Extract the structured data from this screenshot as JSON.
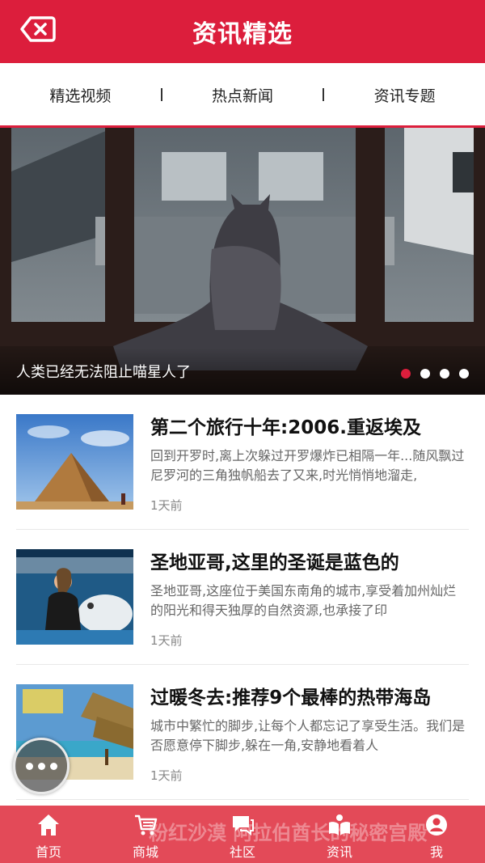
{
  "header": {
    "title": "资讯精选"
  },
  "tabs": [
    {
      "label": "精选视频"
    },
    {
      "label": "热点新闻"
    },
    {
      "label": "资讯专题"
    }
  ],
  "banner": {
    "caption": "人类已经无法阻止喵星人了",
    "slide_count": 4,
    "active_slide": 1
  },
  "articles": [
    {
      "title": "第二个旅行十年:2006.重返埃及",
      "desc": "回到开罗时,离上次躲过开罗爆炸已相隔一年...随风飘过尼罗河的三角独帆船去了又来,时光悄悄地溜走,",
      "time": "1天前",
      "thumb": "pyramid"
    },
    {
      "title": "圣地亚哥,这里的圣诞是蓝色的",
      "desc": "圣地亚哥,这座位于美国东南角的城市,享受着加州灿烂的阳光和得天独厚的自然资源,也承接了印",
      "time": "1天前",
      "thumb": "beluga"
    },
    {
      "title": "过暖冬去:推荐9个最棒的热带海岛",
      "desc": "城市中繁忙的脚步,让每个人都忘记了享受生活。我们是否愿意停下脚步,躲在一角,安静地看着人",
      "time": "1天前",
      "thumb": "beach"
    }
  ],
  "ghost_title": "粉红沙漠 阿拉伯酋长的秘密宫殿",
  "bottom_nav": [
    {
      "label": "首页",
      "icon": "home-icon"
    },
    {
      "label": "商城",
      "icon": "cart-icon"
    },
    {
      "label": "社区",
      "icon": "chat-icon"
    },
    {
      "label": "资讯",
      "icon": "news-icon"
    },
    {
      "label": "我",
      "icon": "user-icon"
    }
  ],
  "colors": {
    "brand": "#dc1e3c",
    "nav_bg": "#e13c4b"
  }
}
